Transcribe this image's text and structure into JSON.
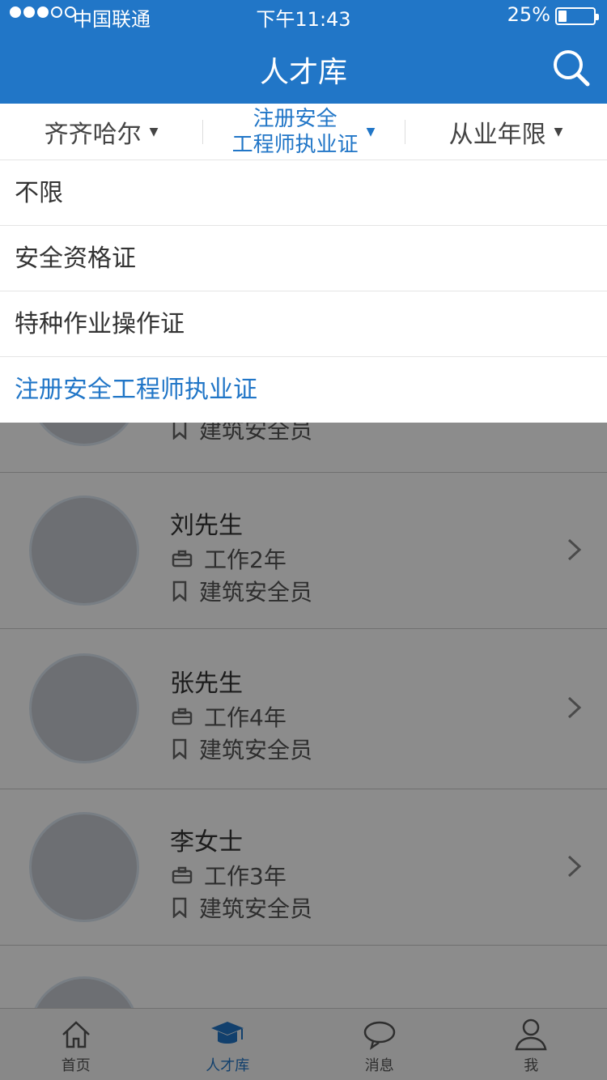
{
  "status_bar": {
    "carrier": "中国联通",
    "time": "下午11:43",
    "battery": "25%",
    "signal_strength": 3
  },
  "header": {
    "title": "人才库",
    "search_icon": "search-icon"
  },
  "filters": [
    {
      "label": "齐齐哈尔"
    },
    {
      "label_line1": "注册安全",
      "label_line2": "工程师执业证"
    },
    {
      "label": "从业年限"
    }
  ],
  "dropdown": {
    "options": [
      "不限",
      "安全资格证",
      "特种作业操作证",
      "注册安全工程师执业证"
    ],
    "selected": "注册安全工程师执业证"
  },
  "candidates": [
    {
      "name": "",
      "years": "",
      "role": "建筑安全员"
    },
    {
      "name": "刘先生",
      "years": "工作2年",
      "role": "建筑安全员"
    },
    {
      "name": "张先生",
      "years": "工作4年",
      "role": "建筑安全员"
    },
    {
      "name": "李女士",
      "years": "工作3年",
      "role": "建筑安全员"
    }
  ],
  "tabbar": {
    "items": [
      {
        "label": "首页",
        "icon": "home-icon"
      },
      {
        "label": "人才库",
        "icon": "graduation-cap-icon"
      },
      {
        "label": "消息",
        "icon": "chat-icon"
      },
      {
        "label": "我",
        "icon": "user-icon"
      }
    ],
    "active": "人才库"
  },
  "colors": {
    "accent": "#2176c7"
  }
}
